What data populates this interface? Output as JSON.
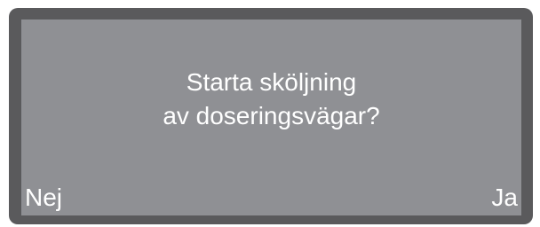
{
  "dialog": {
    "message_line1": "Starta sköljning",
    "message_line2": "av doseringsvägar?",
    "left_softkey_label": "Nej",
    "right_softkey_label": "Ja"
  },
  "colors": {
    "bezel": "#5a5a5c",
    "screen_background": "#8f9094",
    "text": "#ffffff"
  }
}
